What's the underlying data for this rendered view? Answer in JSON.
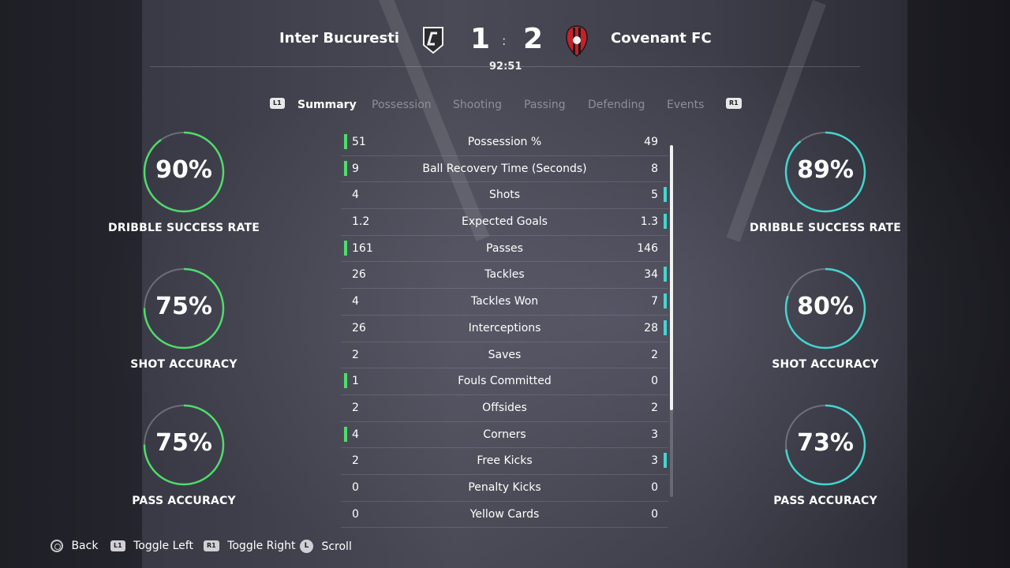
{
  "match": {
    "home_team": "Inter Bucuresti",
    "away_team": "Covenant FC",
    "home_score": "1",
    "away_score": "2",
    "separator": ":",
    "clock": "92:51"
  },
  "tabs": {
    "left_button": "L1",
    "right_button": "R1",
    "items": [
      "Summary",
      "Possession",
      "Shooting",
      "Passing",
      "Defending",
      "Events"
    ],
    "active": "Summary"
  },
  "home_rings": [
    {
      "value": "90%",
      "label": "DRIBBLE SUCCESS RATE",
      "fraction": 0.9
    },
    {
      "value": "75%",
      "label": "SHOT ACCURACY",
      "fraction": 0.75
    },
    {
      "value": "75%",
      "label": "PASS ACCURACY",
      "fraction": 0.75
    }
  ],
  "away_rings": [
    {
      "value": "89%",
      "label": "DRIBBLE SUCCESS RATE",
      "fraction": 0.89
    },
    {
      "value": "80%",
      "label": "SHOT ACCURACY",
      "fraction": 0.8
    },
    {
      "value": "73%",
      "label": "PASS ACCURACY",
      "fraction": 0.73
    }
  ],
  "stats": [
    {
      "name": "Possession %",
      "home": "51",
      "away": "49",
      "leader": "home"
    },
    {
      "name": "Ball Recovery Time (Seconds)",
      "home": "9",
      "away": "8",
      "leader": "home"
    },
    {
      "name": "Shots",
      "home": "4",
      "away": "5",
      "leader": "away"
    },
    {
      "name": "Expected Goals",
      "home": "1.2",
      "away": "1.3",
      "leader": "away"
    },
    {
      "name": "Passes",
      "home": "161",
      "away": "146",
      "leader": "home"
    },
    {
      "name": "Tackles",
      "home": "26",
      "away": "34",
      "leader": "away"
    },
    {
      "name": "Tackles Won",
      "home": "4",
      "away": "7",
      "leader": "away"
    },
    {
      "name": "Interceptions",
      "home": "26",
      "away": "28",
      "leader": "away"
    },
    {
      "name": "Saves",
      "home": "2",
      "away": "2",
      "leader": "none"
    },
    {
      "name": "Fouls Committed",
      "home": "1",
      "away": "0",
      "leader": "home"
    },
    {
      "name": "Offsides",
      "home": "2",
      "away": "2",
      "leader": "none"
    },
    {
      "name": "Corners",
      "home": "4",
      "away": "3",
      "leader": "home"
    },
    {
      "name": "Free Kicks",
      "home": "2",
      "away": "3",
      "leader": "away"
    },
    {
      "name": "Penalty Kicks",
      "home": "0",
      "away": "0",
      "leader": "none"
    },
    {
      "name": "Yellow Cards",
      "home": "0",
      "away": "0",
      "leader": "none"
    }
  ],
  "footer": {
    "back": "Back",
    "toggle_left_button": "L1",
    "toggle_left": "Toggle Left",
    "toggle_right_button": "R1",
    "toggle_right": "Toggle Right",
    "scroll_button": "L",
    "scroll": "Scroll"
  },
  "colors": {
    "home_accent": "#4fdc6b",
    "away_accent": "#43d6cf"
  }
}
